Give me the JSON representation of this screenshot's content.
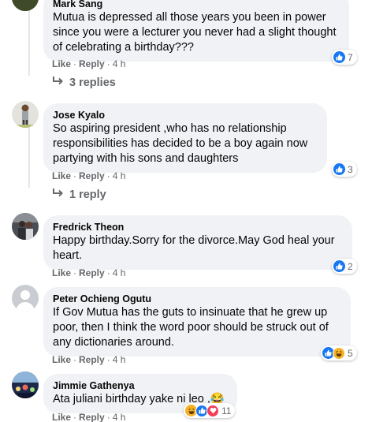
{
  "comments": [
    {
      "author": "Mark Sang",
      "text": "Mutua is depressed all those years you been in power since you were a lecturer you never had a slight thought of celebrating a birthday???",
      "like_label": "Like",
      "reply_label": "Reply",
      "time": "4 h",
      "reaction_count": "7",
      "reactions": [
        "like-icon"
      ],
      "replies_label": "3 replies"
    },
    {
      "author": "Jose Kyalo",
      "text": "So aspiring president ,who has no relationship responsibilities has decided to be a boy again now partying with his sons and daughters",
      "like_label": "Like",
      "reply_label": "Reply",
      "time": "4 h",
      "reaction_count": "3",
      "reactions": [
        "like-icon"
      ],
      "replies_label": "1 reply"
    },
    {
      "author": "Fredrick Theon",
      "text": "Happy birthday.Sorry for the divorce.May God heal your heart.",
      "like_label": "Like",
      "reply_label": "Reply",
      "time": "4 h",
      "reaction_count": "2",
      "reactions": [
        "like-icon"
      ]
    },
    {
      "author": "Peter Ochieng Ogutu",
      "text": "If Gov Mutua has the guts to insinuate that he grew up poor, then I think the word poor should be struck out of any dictionaries around.",
      "like_label": "Like",
      "reply_label": "Reply",
      "time": "4 h",
      "reaction_count": "5",
      "reactions": [
        "like-icon",
        "haha-icon"
      ]
    },
    {
      "author": "Jimmie Gathenya",
      "text": "Ata juliani birthday yake ni leo ,😂",
      "like_label": "Like",
      "reply_label": "Reply",
      "time": "4 h",
      "reaction_count": "11",
      "reactions": [
        "haha-icon",
        "like-icon",
        "love-icon"
      ]
    }
  ],
  "colors": {
    "bubble": "#f0f2f5",
    "secondary_text": "#65676b",
    "like_blue": "#1877f2",
    "haha_yellow": "#f7b125",
    "love_red": "#f33e58"
  }
}
